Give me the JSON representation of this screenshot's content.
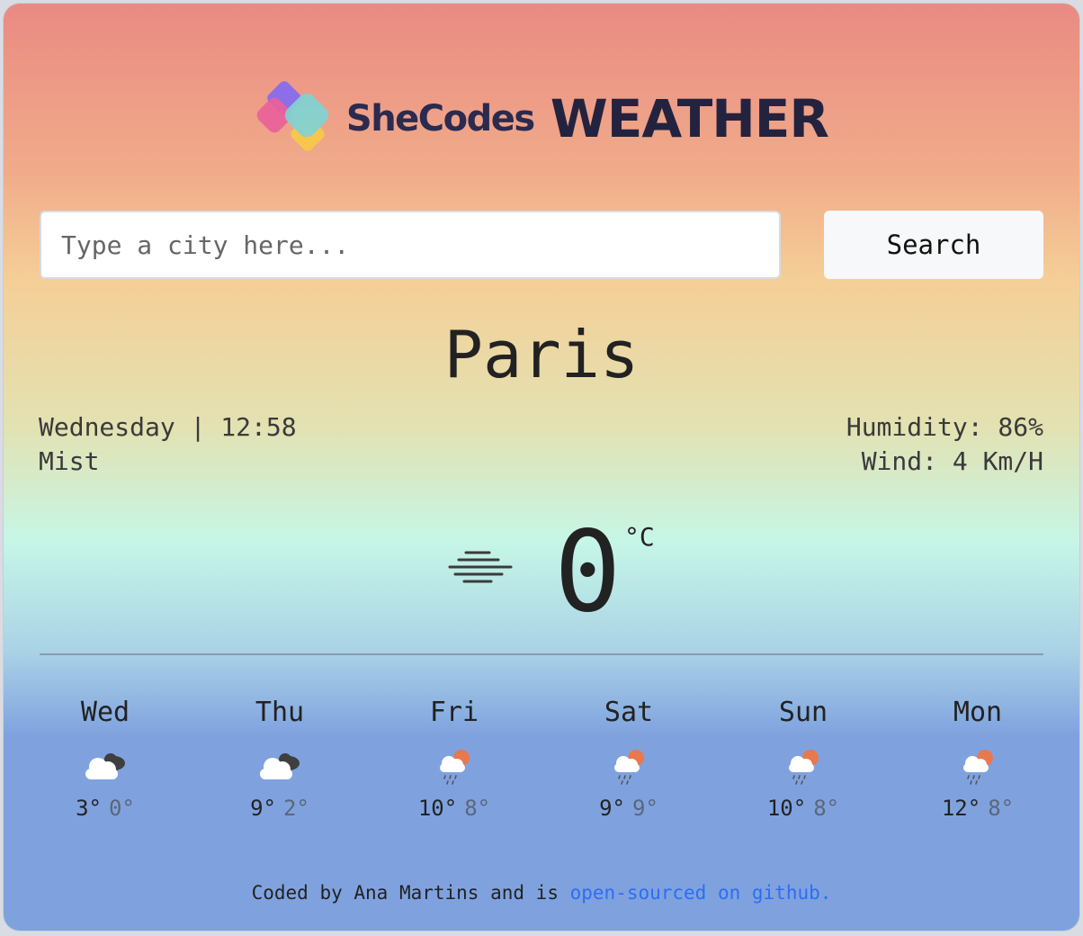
{
  "brand": {
    "name": "SheCodes",
    "title": "WEATHER"
  },
  "search": {
    "placeholder": "Type a city here...",
    "button_label": "Search"
  },
  "current": {
    "city": "Paris",
    "datetime": "Wednesday | 12:58",
    "description": "Mist",
    "humidity": "Humidity: 86%",
    "wind": "Wind: 4 Km/H",
    "temperature": "0",
    "unit": "°C",
    "icon": "mist-icon"
  },
  "forecast": [
    {
      "day": "Wed",
      "max": "3°",
      "min": "0°",
      "icon": "cloudy-icon"
    },
    {
      "day": "Thu",
      "max": "9°",
      "min": "2°",
      "icon": "cloudy-icon"
    },
    {
      "day": "Fri",
      "max": "10°",
      "min": "8°",
      "icon": "rain-sun-icon"
    },
    {
      "day": "Sat",
      "max": "9°",
      "min": "9°",
      "icon": "rain-sun-icon"
    },
    {
      "day": "Sun",
      "max": "10°",
      "min": "8°",
      "icon": "rain-sun-icon"
    },
    {
      "day": "Mon",
      "max": "12°",
      "min": "8°",
      "icon": "rain-sun-icon"
    }
  ],
  "footer": {
    "prefix": "Coded by Ana Martins and is ",
    "link_text": "open-sourced on github."
  },
  "colors": {
    "link": "#2c6ef2",
    "title": "#24233f",
    "card_top": "#ea8a83",
    "card_bottom": "#7fa2df"
  }
}
